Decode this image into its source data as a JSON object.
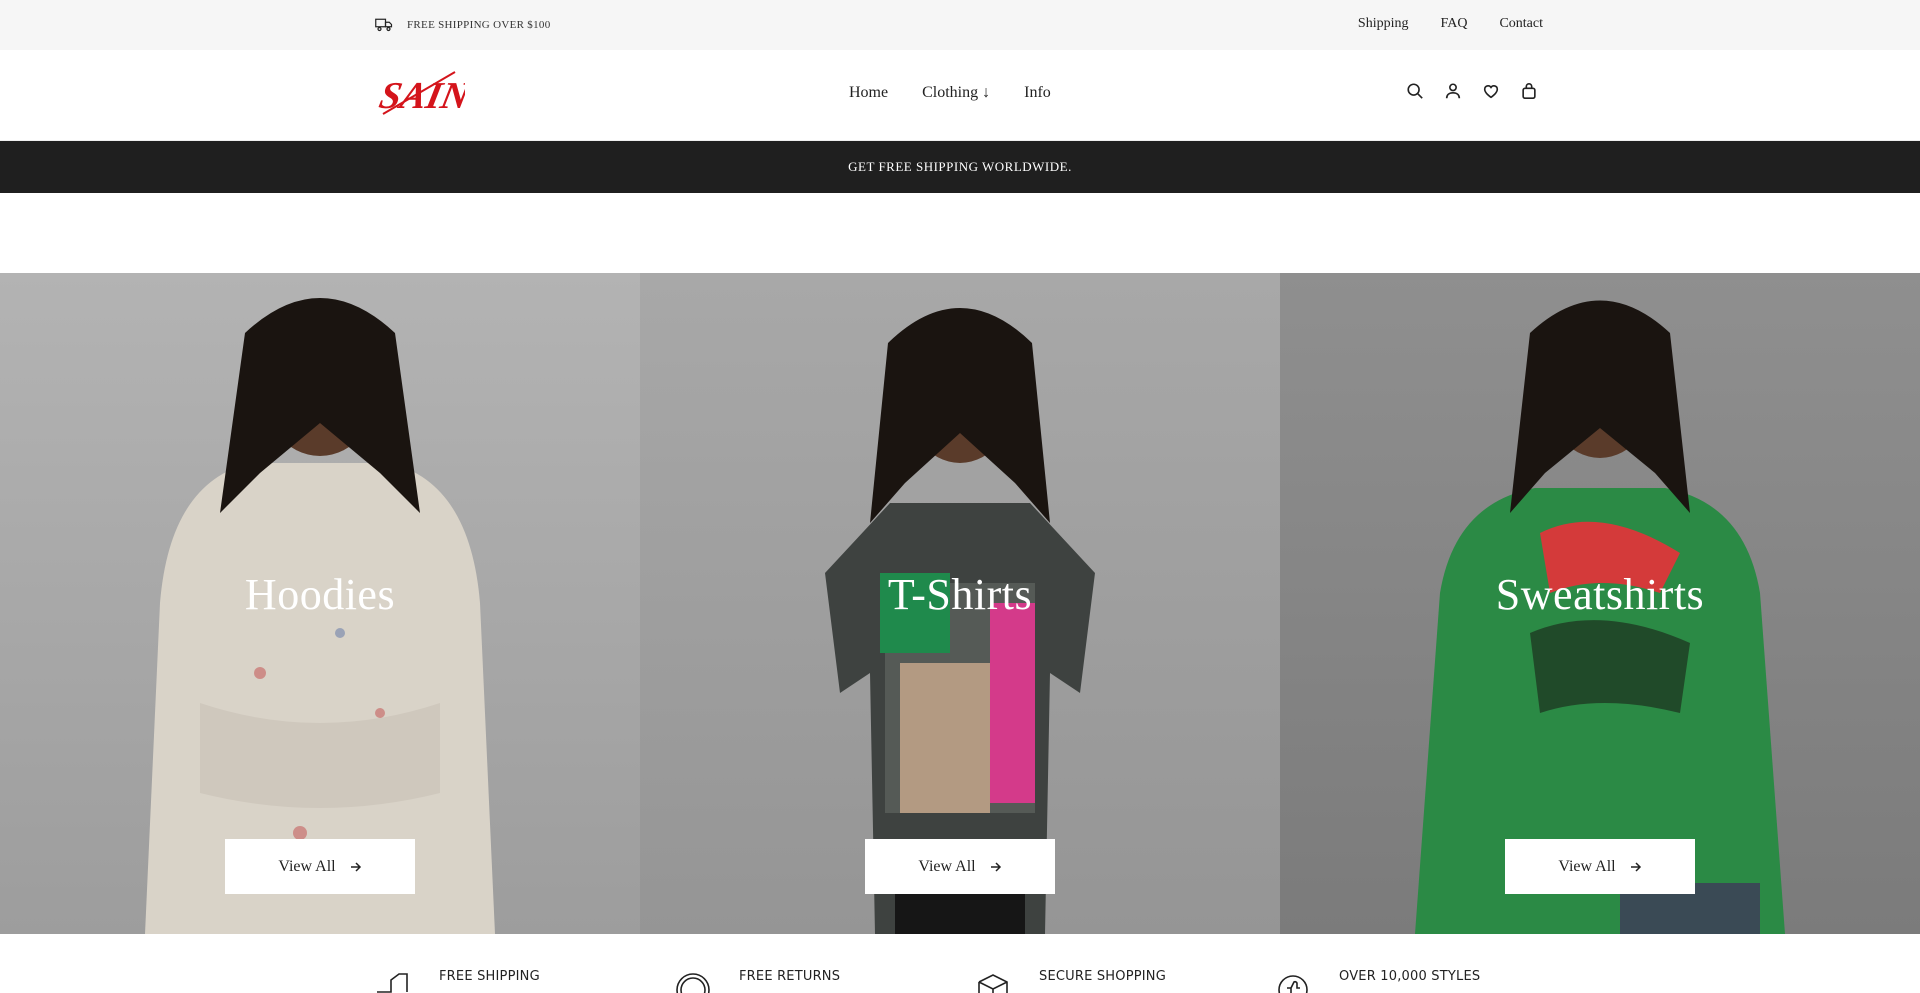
{
  "topbar": {
    "shipping_text": "FREE SHIPPING OVER $100",
    "links": [
      "Shipping",
      "FAQ",
      "Contact"
    ]
  },
  "header": {
    "logo_text": "SAINT",
    "nav": [
      "Home",
      "Clothing ↓",
      "Info"
    ],
    "icons": [
      "search-icon",
      "user-icon",
      "heart-icon",
      "bag-icon"
    ]
  },
  "announcement": {
    "text": "GET FREE SHIPPING WORLDWIDE."
  },
  "collections": [
    {
      "title": "Hoodies",
      "button": "View All"
    },
    {
      "title": "T-Shirts",
      "button": "View All"
    },
    {
      "title": "Sweatshirts",
      "button": "View All"
    }
  ],
  "features": [
    "FREE SHIPPING",
    "FREE RETURNS",
    "SECURE SHOPPING",
    "OVER 10,000 STYLES"
  ],
  "colors": {
    "brand_red": "#d4141b",
    "announcement_bg": "#1f1f1f",
    "topbar_bg": "#f6f6f6"
  }
}
